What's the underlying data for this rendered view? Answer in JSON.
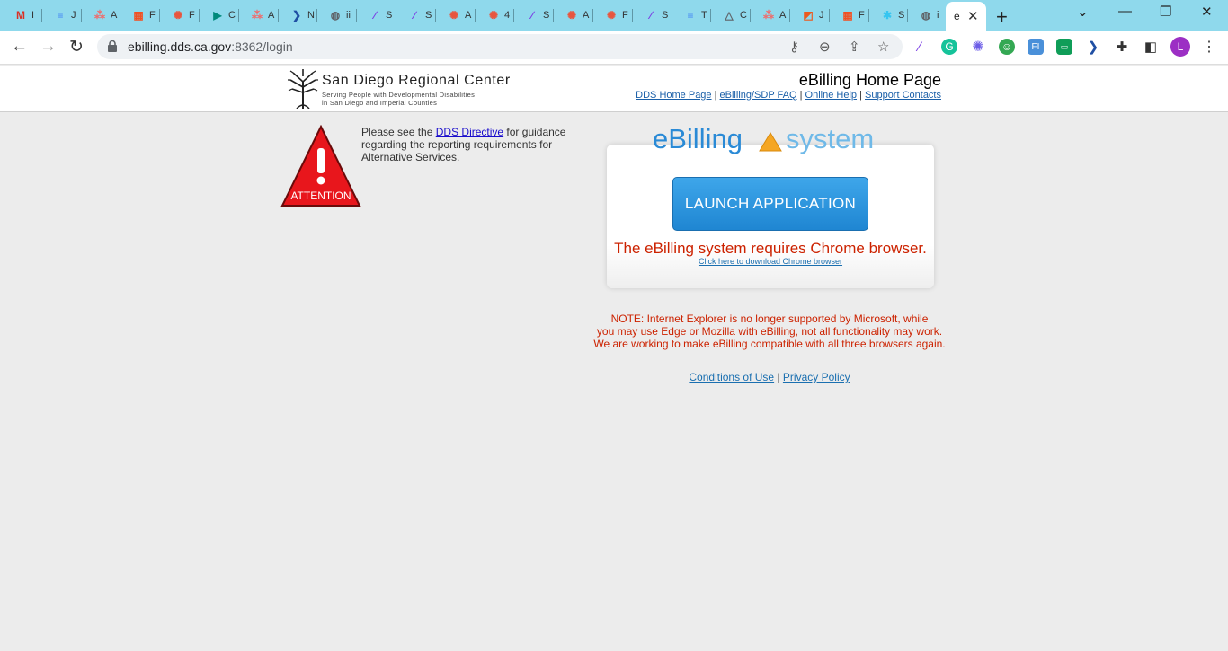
{
  "browser": {
    "tabs": [
      {
        "favicon": "gmail-icon",
        "title": "I",
        "color": "#d93025"
      },
      {
        "favicon": "docs-icon",
        "title": "J",
        "color": "#4285f4"
      },
      {
        "favicon": "asana-icon",
        "title": "A",
        "color": "#f06a6a"
      },
      {
        "favicon": "microsoft-icon",
        "title": "F",
        "color": "#f25022"
      },
      {
        "favicon": "sunburst-icon",
        "title": "F",
        "color": "#e8553e"
      },
      {
        "favicon": "meet-icon",
        "title": "C",
        "color": "#00897b"
      },
      {
        "favicon": "asana-icon",
        "title": "A",
        "color": "#f06a6a"
      },
      {
        "favicon": "chevron-icon",
        "title": "N",
        "color": "#1f4fa3"
      },
      {
        "favicon": "globe-icon",
        "title": "ii",
        "color": "#5f6368"
      },
      {
        "favicon": "feather-icon",
        "title": "S",
        "color": "#7b3fe4"
      },
      {
        "favicon": "feather-icon",
        "title": "S",
        "color": "#7b3fe4"
      },
      {
        "favicon": "sunburst-icon",
        "title": "A",
        "color": "#e8553e"
      },
      {
        "favicon": "sunburst-icon",
        "title": "4",
        "color": "#e8553e"
      },
      {
        "favicon": "feather-icon",
        "title": "S",
        "color": "#7b3fe4"
      },
      {
        "favicon": "sunburst-icon",
        "title": "A",
        "color": "#e8553e"
      },
      {
        "favicon": "sunburst-icon",
        "title": "F",
        "color": "#e8553e"
      },
      {
        "favicon": "feather-icon",
        "title": "S",
        "color": "#7b3fe4"
      },
      {
        "favicon": "docs-icon",
        "title": "T",
        "color": "#4285f4"
      },
      {
        "favicon": "triangle-icon",
        "title": "C",
        "color": "#5f6368"
      },
      {
        "favicon": "asana-icon",
        "title": "A",
        "color": "#f06a6a"
      },
      {
        "favicon": "office-icon",
        "title": "J",
        "color": "#eb5a1e"
      },
      {
        "favicon": "microsoft-icon",
        "title": "F",
        "color": "#f25022"
      },
      {
        "favicon": "slack-icon",
        "title": "S",
        "color": "#36c5f0"
      },
      {
        "favicon": "globe-icon",
        "title": "i",
        "color": "#5f6368"
      }
    ],
    "active_tab": {
      "title": "e"
    },
    "url_host": "ebilling.dds.ca.gov",
    "url_path": ":8362/login",
    "profile_initial": "L",
    "accent": "#8fd9ec"
  },
  "header": {
    "org_name": "San Diego Regional Center",
    "org_tagline_1": "Serving People with Developmental Disabilities",
    "org_tagline_2": "in San Diego and Imperial Counties",
    "page_title": "eBilling Home Page",
    "links": [
      "DDS Home Page",
      "eBilling/SDP FAQ",
      "Online Help",
      "Support Contacts"
    ],
    "separator": "|"
  },
  "notice": {
    "attention_label": "ATTENTION",
    "text_before": "Please see the ",
    "link": "DDS Directive",
    "text_after": " for guidance regarding the reporting requirements for Alternative Services."
  },
  "app": {
    "logo_text_1": "eBilling",
    "logo_text_2": "system",
    "launch_label": "LAUNCH APPLICATION",
    "chrome_requirement": "The eBilling system requires Chrome browser.",
    "chrome_link": "Click here to download Chrome browser"
  },
  "ie_note": {
    "line1": "NOTE: Internet Explorer is no longer supported by Microsoft, while",
    "line2": "you may use Edge or Mozilla with eBilling, not all functionality may work.",
    "line3": "We are working to make eBilling compatible with all three browsers again."
  },
  "footer": {
    "conditions": "Conditions of Use",
    "separator": "|",
    "privacy": "Privacy Policy"
  }
}
